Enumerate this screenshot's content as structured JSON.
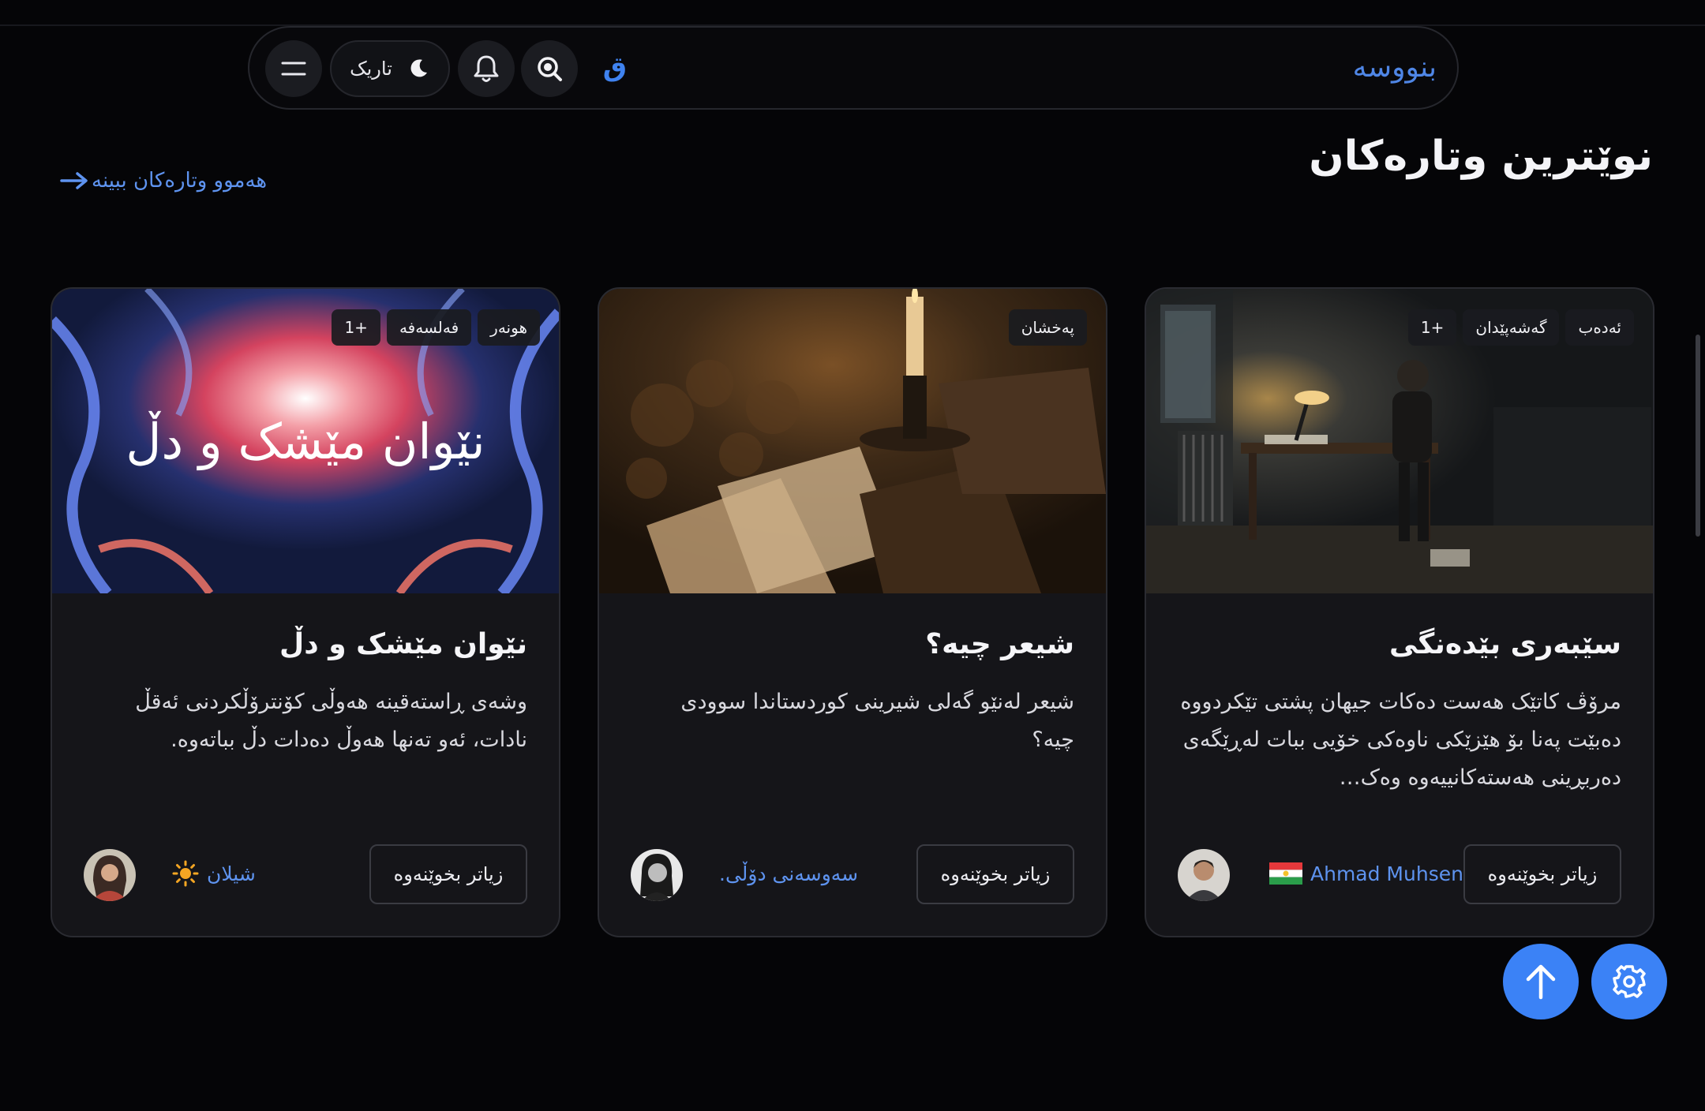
{
  "nav": {
    "brand": "بنووسە",
    "logo": "ق",
    "theme_label": "تاریک",
    "icons": [
      "menu-icon",
      "moon-icon",
      "bell-icon",
      "search-icon"
    ]
  },
  "section": {
    "title": "نوێترین وتارەکان",
    "view_all": "هەموو وتارەکان ببینە"
  },
  "cards": [
    {
      "tags": [
        "ئەدەب",
        "گەشەپێدان",
        "+1"
      ],
      "title": "سێبەری بێدەنگی",
      "excerpt": "مرۆڤ کاتێک هەست دەکات جیهان پشتی تێکردووە دەبێت پەنا بۆ هێزێکی ناوەکی خۆیی ببات لەڕێگەی دەربڕینی هەستەکانییەوە وەک…",
      "read_more": "زیاتر بخوێنەوە",
      "author": "Ahmad Muhsen"
    },
    {
      "tags": [
        "پەخشان"
      ],
      "title": "شیعر چیە؟",
      "excerpt": "شیعر لەنێو گەلی شیرینی کوردستاندا سوودی چیە؟",
      "read_more": "زیاتر بخوێنەوە",
      "author": "سەوسەنی دۆڵی."
    },
    {
      "tags": [
        "هونەر",
        "فەلسەفە",
        "+1"
      ],
      "title": "نێوان مێشک و دڵ",
      "excerpt": "وشەی ڕاستەقینە هەوڵی کۆنترۆڵکردنی ئەقڵ نادات، ئەو تەنها هەوڵ دەدات دڵ بباتەوە.",
      "read_more": "زیاتر بخوێنەوە",
      "author": "شیلان",
      "image_text": "نێوان مێشک و دڵ"
    }
  ],
  "colors": {
    "accent": "#3b82f6",
    "link": "#5e93ef",
    "card_bg": "#151519",
    "page_bg": "#050507"
  }
}
